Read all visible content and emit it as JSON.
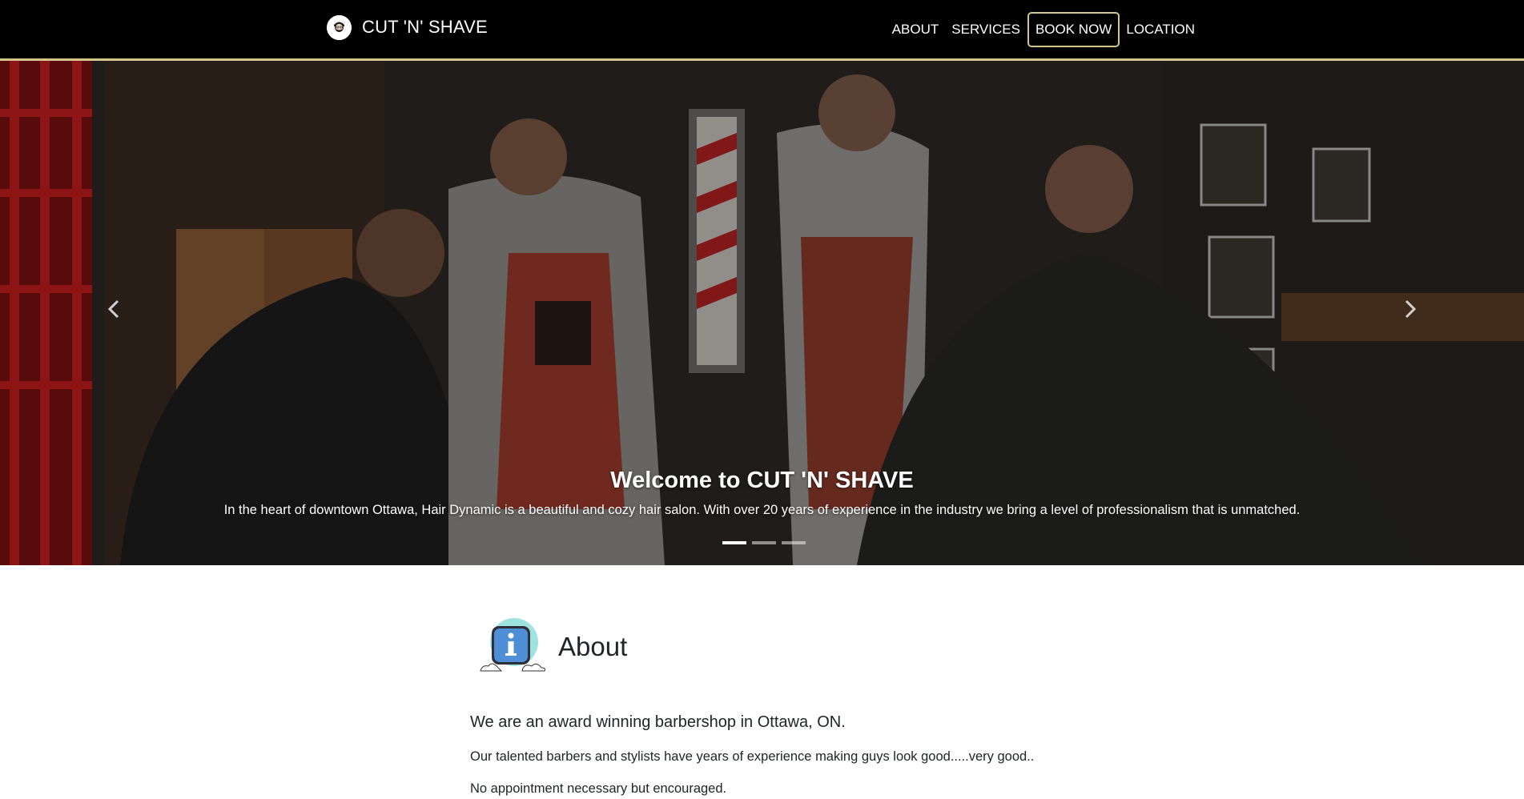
{
  "navbar": {
    "brand": "CUT 'N' SHAVE",
    "links": [
      {
        "label": "ABOUT"
      },
      {
        "label": "SERVICES"
      },
      {
        "label": "BOOK NOW"
      },
      {
        "label": "LOCATION"
      }
    ],
    "accent_color": "#d4c58a"
  },
  "hero": {
    "title": "Welcome to CUT 'N' SHAVE",
    "subtitle": "In the heart of downtown Ottawa, Hair Dynamic is a beautiful and cozy hair salon. With over 20 years of experience in the industry we bring a level of professionalism that is unmatched.",
    "slide_count": 3,
    "active_slide": 1
  },
  "about": {
    "title": "About",
    "lead": "We are an award winning barbershop in Ottawa, ON.",
    "paragraphs": [
      "Our talented barbers and stylists have years of experience making guys look good.....very good..",
      "No appointment necessary but encouraged."
    ]
  }
}
